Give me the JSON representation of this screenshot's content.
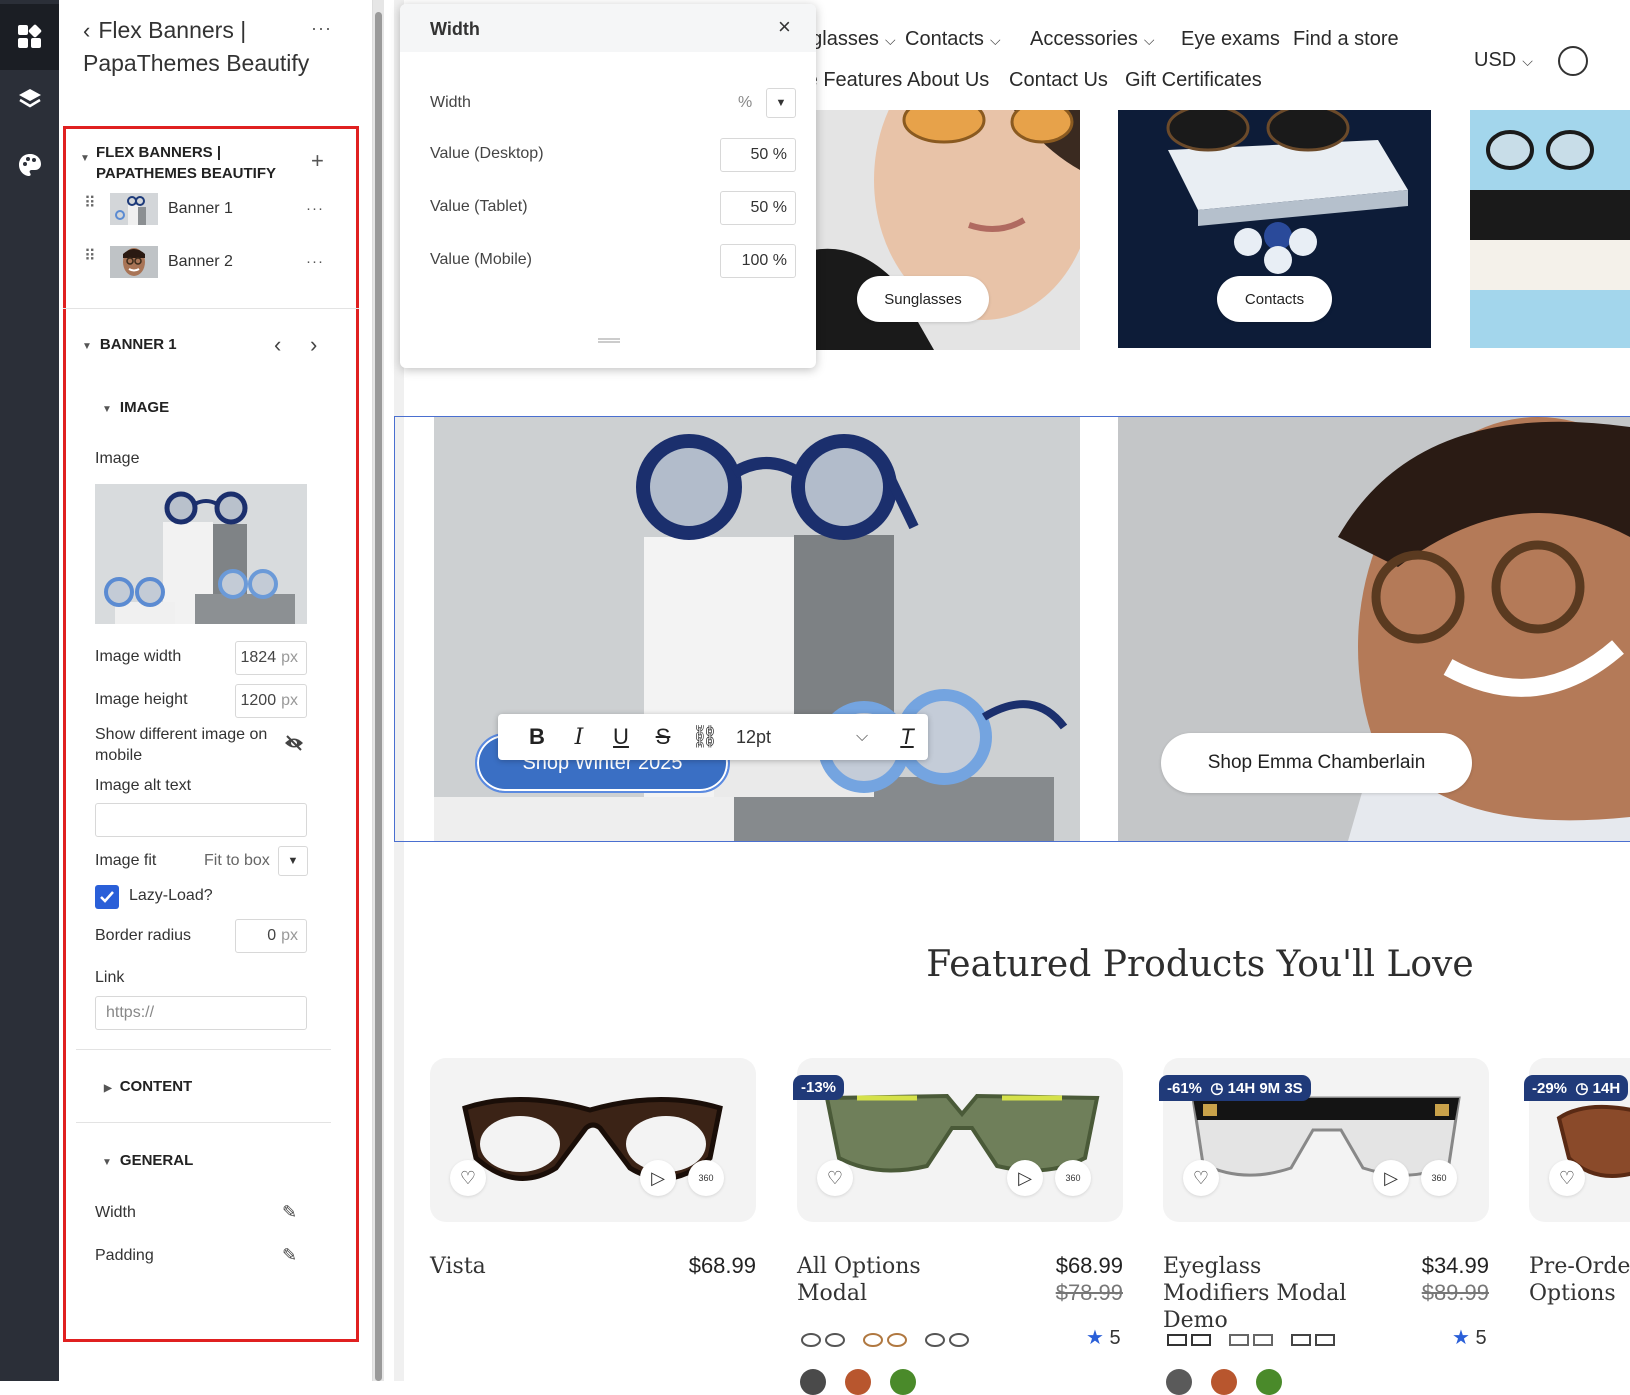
{
  "panel": {
    "title": "Flex Banners | PapaThemes Beautify",
    "section_title": "FLEX BANNERS | PAPATHEMES BEAUTIFY",
    "items": [
      {
        "label": "Banner 1"
      },
      {
        "label": "Banner 2"
      }
    ],
    "banner_section": "BANNER 1",
    "image_section": "IMAGE",
    "image_label": "Image",
    "image_width_label": "Image width",
    "image_width_value": "1824",
    "image_height_label": "Image height",
    "image_height_value": "1200",
    "px": "px",
    "show_mobile_label": "Show different image on mobile",
    "alt_label": "Image alt text",
    "alt_value": "",
    "fit_label": "Image fit",
    "fit_value": "Fit to box",
    "lazy_label": "Lazy-Load?",
    "lazy_checked": true,
    "radius_label": "Border radius",
    "radius_value": "0",
    "link_label": "Link",
    "link_placeholder": "https://",
    "content_section": "CONTENT",
    "general_section": "GENERAL",
    "width_label": "Width",
    "padding_label": "Padding"
  },
  "popup": {
    "title": "Width",
    "width_label": "Width",
    "unit": "%",
    "desktop_label": "Value (Desktop)",
    "desktop_value": "50 %",
    "tablet_label": "Value (Tablet)",
    "tablet_value": "50 %",
    "mobile_label": "Value (Mobile)",
    "mobile_value": "100 %"
  },
  "nav": {
    "row1": [
      "nglasses",
      "Contacts",
      "Accessories",
      "Eye exams",
      "Find a store"
    ],
    "row2": [
      "me Features",
      "About Us",
      "Contact Us",
      "Gift Certificates"
    ],
    "currency": "USD"
  },
  "tiles": {
    "sunglasses": "Sunglasses",
    "contacts": "Contacts"
  },
  "banners": {
    "button1": "Shop Winter 2025",
    "button2": "Shop Emma Chamberlain"
  },
  "toolbar": {
    "bold": "B",
    "italic": "I",
    "underline": "U",
    "strike": "S",
    "font_size": "12pt"
  },
  "featured": {
    "heading": "Featured Products You'll Love",
    "products": [
      {
        "name": "Vista",
        "price": "$68.99",
        "old": "",
        "badge": ""
      },
      {
        "name": "All Options Modal",
        "price": "$68.99",
        "old": "$78.99",
        "badge": "-13%",
        "rating": "5"
      },
      {
        "name": "Eyeglass Modifiers Modal Demo",
        "price": "$34.99",
        "old": "$89.99",
        "badge": "-61%",
        "timer": "14H 9M 3S",
        "rating": "5"
      },
      {
        "name": "Pre-Order Options",
        "badge": "-29%",
        "timer": "14H"
      }
    ]
  },
  "colors": {
    "accent": "#3a6fc4",
    "badge": "#203a79",
    "red_outline": "#e02020",
    "rail": "#2b2f38"
  }
}
